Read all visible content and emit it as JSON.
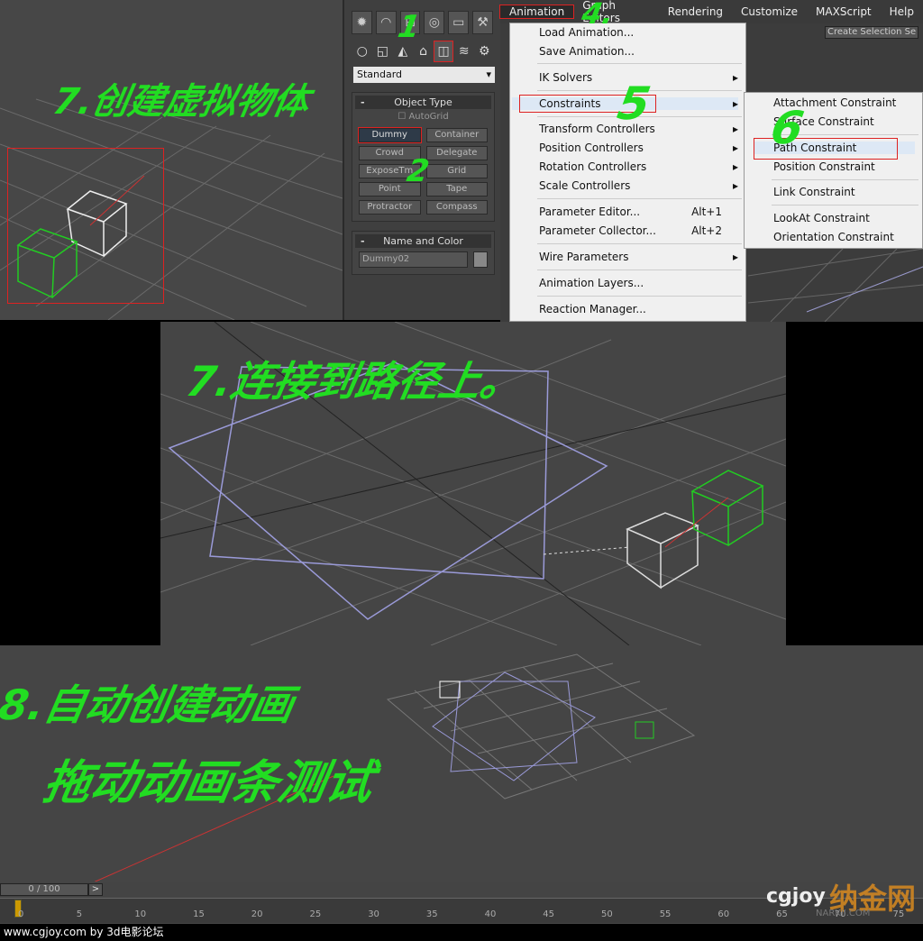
{
  "annotations": {
    "step7a": "7.创建虚拟物体",
    "step7b": "7.连接到路径上。",
    "step8a": "8.自动创建动画",
    "step8b": "拖动动画条测试",
    "n1": "1",
    "n2": "2",
    "n4": "4.",
    "n5": "5",
    "n6": "6"
  },
  "command_panel": {
    "tabs": [
      "create-icon",
      "modify-icon",
      "hierarchy-icon",
      "motion-icon",
      "display-icon",
      "utilities-icon"
    ],
    "category": "Standard",
    "object_type_title": "Object Type",
    "autogrid": "AutoGrid",
    "buttons": [
      "Dummy",
      "Container",
      "Crowd",
      "Delegate",
      "ExposeTm",
      "Grid",
      "Point",
      "Tape",
      "Protractor",
      "Compass"
    ],
    "name_color_title": "Name and Color",
    "name_value": "Dummy02",
    "collapse": "-"
  },
  "menubar": {
    "items": [
      "Animation",
      "Graph Editors",
      "Rendering",
      "Customize",
      "MAXScript",
      "Help"
    ]
  },
  "toolbar": {
    "selection_set_placeholder": "Create Selection Se"
  },
  "animation_menu": {
    "items": [
      {
        "label": "Load Animation..."
      },
      {
        "label": "Save Animation..."
      },
      {
        "label": "IK Solvers",
        "arrow": "▸"
      },
      {
        "label": "Constraints",
        "arrow": "▸"
      },
      {
        "label": "Transform Controllers",
        "arrow": "▸"
      },
      {
        "label": "Position Controllers",
        "arrow": "▸"
      },
      {
        "label": "Rotation Controllers",
        "arrow": "▸"
      },
      {
        "label": "Scale Controllers",
        "arrow": "▸"
      },
      {
        "label": "Parameter Editor...",
        "shortcut": "Alt+1"
      },
      {
        "label": "Parameter Collector...",
        "shortcut": "Alt+2"
      },
      {
        "label": "Wire Parameters",
        "arrow": "▸"
      },
      {
        "label": "Animation Layers..."
      },
      {
        "label": "Reaction Manager..."
      }
    ]
  },
  "constraints_submenu": {
    "items": [
      "Attachment Constraint",
      "Surface Constraint",
      "Path Constraint",
      "Position Constraint",
      "Link Constraint",
      "LookAt Constraint",
      "Orientation Constraint"
    ]
  },
  "timeline": {
    "frame_display": "0 / 100",
    "next": ">",
    "current_frame": 0,
    "ticks": [
      "0",
      "5",
      "10",
      "15",
      "20",
      "25",
      "30",
      "35",
      "40",
      "45",
      "50",
      "55",
      "60",
      "65",
      "70",
      "75"
    ]
  },
  "watermark": {
    "logo": "cgjoy",
    "logo2": "纳金网",
    "url": "NARKII.COM"
  },
  "footer": {
    "text": "www.cgjoy.com by 3d电影论坛"
  },
  "colors": {
    "highlight_red": "#dd2222",
    "annotation_green": "#22dd22",
    "selected_box": "#22cc22",
    "path": "#9a9ad8"
  }
}
